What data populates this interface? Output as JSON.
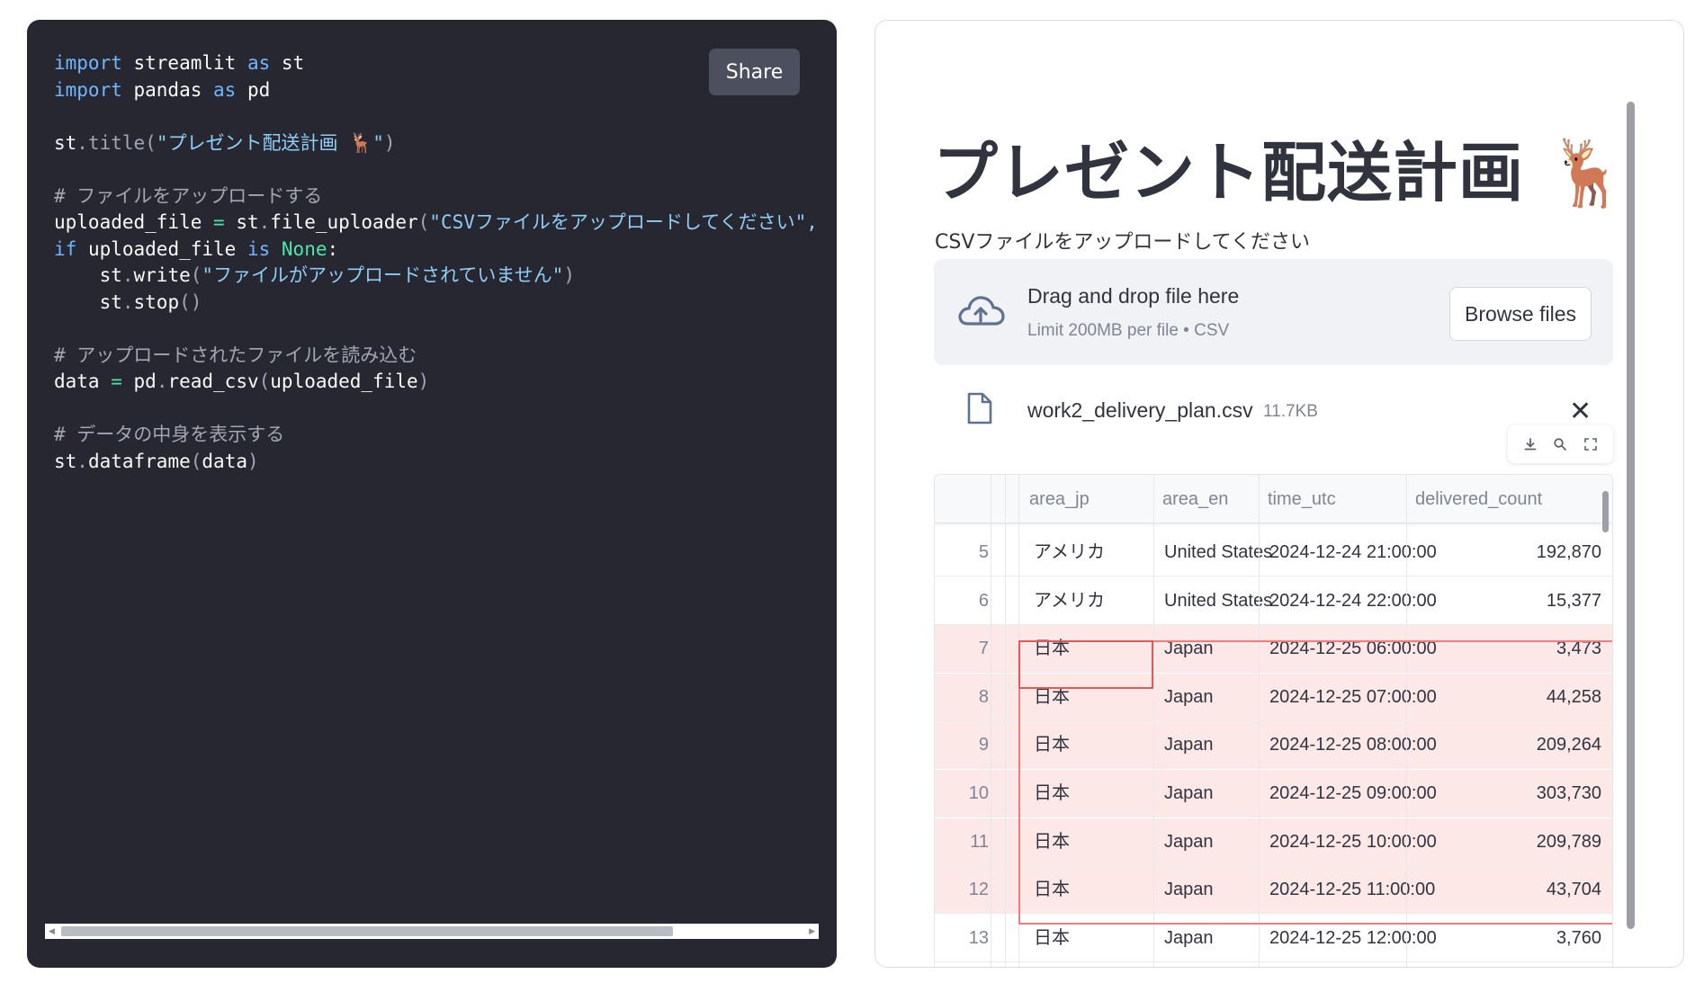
{
  "code_panel": {
    "share_label": "Share",
    "lines": [
      [
        {
          "t": "import",
          "c": "kw"
        },
        {
          "t": " streamlit "
        },
        {
          "t": "as",
          "c": "kw"
        },
        {
          "t": " st"
        }
      ],
      [
        {
          "t": "import",
          "c": "kw"
        },
        {
          "t": " pandas "
        },
        {
          "t": "as",
          "c": "kw"
        },
        {
          "t": " pd"
        }
      ],
      [],
      [
        {
          "t": "st"
        },
        {
          "t": ".title(",
          "c": "cmt"
        },
        {
          "t": "\"プレゼント配送計画 🦌\"",
          "c": "str"
        },
        {
          "t": ")",
          "c": "cmt"
        }
      ],
      [],
      [
        {
          "t": "# ファイルをアップロードする",
          "c": "cmt"
        }
      ],
      [
        {
          "t": "uploaded_file "
        },
        {
          "t": "=",
          "c": "lit"
        },
        {
          "t": " st"
        },
        {
          "t": ".",
          "c": "cmt"
        },
        {
          "t": "file_uploader"
        },
        {
          "t": "(",
          "c": "cmt"
        },
        {
          "t": "\"CSVファイルをアップロードしてください\",",
          "c": "str"
        }
      ],
      [
        {
          "t": "if",
          "c": "kw"
        },
        {
          "t": " uploaded_file "
        },
        {
          "t": "is",
          "c": "kw"
        },
        {
          "t": " "
        },
        {
          "t": "None",
          "c": "lit"
        },
        {
          "t": ":"
        }
      ],
      [
        {
          "t": "    st"
        },
        {
          "t": ".",
          "c": "cmt"
        },
        {
          "t": "write"
        },
        {
          "t": "(",
          "c": "cmt"
        },
        {
          "t": "\"ファイルがアップロードされていません\"",
          "c": "str"
        },
        {
          "t": ")",
          "c": "cmt"
        }
      ],
      [
        {
          "t": "    st"
        },
        {
          "t": ".",
          "c": "cmt"
        },
        {
          "t": "stop"
        },
        {
          "t": "()",
          "c": "cmt"
        }
      ],
      [],
      [
        {
          "t": "# アップロードされたファイルを読み込む",
          "c": "cmt"
        }
      ],
      [
        {
          "t": "data "
        },
        {
          "t": "=",
          "c": "lit"
        },
        {
          "t": " pd"
        },
        {
          "t": ".",
          "c": "cmt"
        },
        {
          "t": "read_csv"
        },
        {
          "t": "(",
          "c": "cmt"
        },
        {
          "t": "uploaded_file"
        },
        {
          "t": ")",
          "c": "cmt"
        }
      ],
      [],
      [
        {
          "t": "# データの中身を表示する",
          "c": "cmt"
        }
      ],
      [
        {
          "t": "st"
        },
        {
          "t": ".",
          "c": "cmt"
        },
        {
          "t": "dataframe"
        },
        {
          "t": "(",
          "c": "cmt"
        },
        {
          "t": "data"
        },
        {
          "t": ")",
          "c": "cmt"
        }
      ]
    ]
  },
  "app": {
    "title": "プレゼント配送計画 🦌",
    "uploader_label": "CSVファイルをアップロードしてください",
    "drop_title": "Drag and drop file here",
    "drop_limit": "Limit 200MB per file • CSV",
    "browse_label": "Browse files",
    "file_name": "work2_delivery_plan.csv",
    "file_size": "11.7KB",
    "close_glyph": "✕",
    "table": {
      "columns": [
        "area_jp",
        "area_en",
        "time_utc",
        "delivered_count"
      ],
      "rows": [
        {
          "idx": "5",
          "area_jp": "アメリカ",
          "area_en": "United States",
          "time_utc": "2024-12-24 21:00:00",
          "delivered_count": "192,870",
          "selected": false
        },
        {
          "idx": "6",
          "area_jp": "アメリカ",
          "area_en": "United States",
          "time_utc": "2024-12-24 22:00:00",
          "delivered_count": "15,377",
          "selected": false
        },
        {
          "idx": "7",
          "area_jp": "日本",
          "area_en": "Japan",
          "time_utc": "2024-12-25 06:00:00",
          "delivered_count": "3,473",
          "selected": true
        },
        {
          "idx": "8",
          "area_jp": "日本",
          "area_en": "Japan",
          "time_utc": "2024-12-25 07:00:00",
          "delivered_count": "44,258",
          "selected": true
        },
        {
          "idx": "9",
          "area_jp": "日本",
          "area_en": "Japan",
          "time_utc": "2024-12-25 08:00:00",
          "delivered_count": "209,264",
          "selected": true
        },
        {
          "idx": "10",
          "area_jp": "日本",
          "area_en": "Japan",
          "time_utc": "2024-12-25 09:00:00",
          "delivered_count": "303,730",
          "selected": true
        },
        {
          "idx": "11",
          "area_jp": "日本",
          "area_en": "Japan",
          "time_utc": "2024-12-25 10:00:00",
          "delivered_count": "209,789",
          "selected": true
        },
        {
          "idx": "12",
          "area_jp": "日本",
          "area_en": "Japan",
          "time_utc": "2024-12-25 11:00:00",
          "delivered_count": "43,704",
          "selected": true
        },
        {
          "idx": "13",
          "area_jp": "日本",
          "area_en": "Japan",
          "time_utc": "2024-12-25 12:00:00",
          "delivered_count": "3,760",
          "selected": false
        }
      ]
    },
    "colors": {
      "code_bg": "#262730",
      "selection_border": "#f07c7c",
      "selection_fill": "#fde8e8"
    }
  }
}
